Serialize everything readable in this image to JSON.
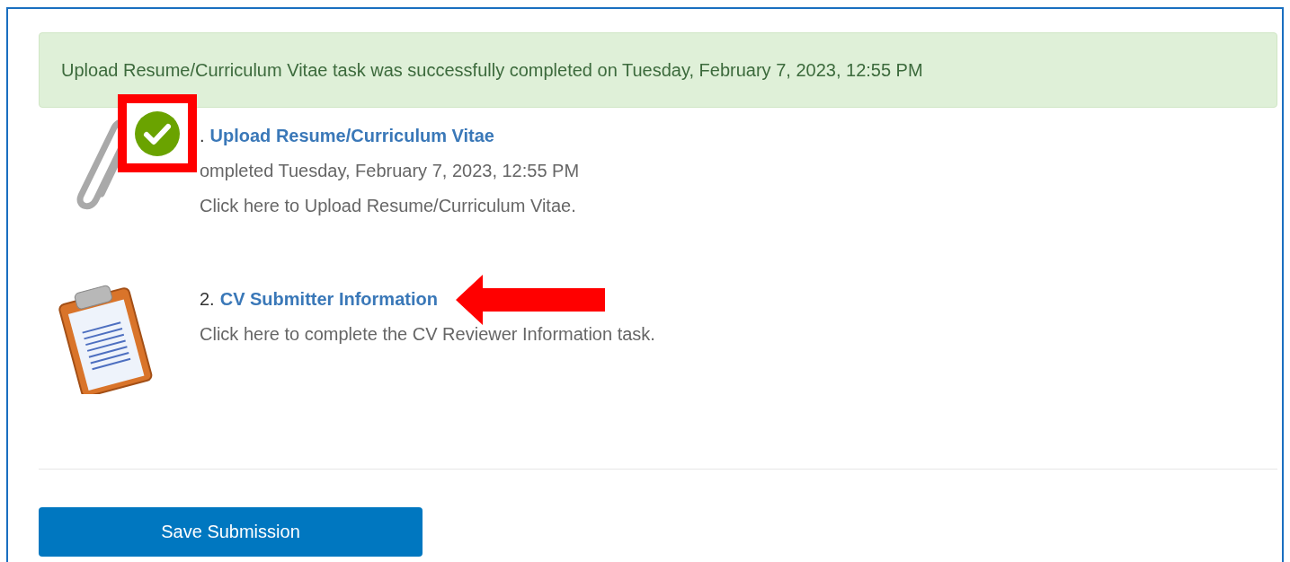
{
  "alert": {
    "text": "Upload Resume/Curriculum Vitae task was successfully completed on Tuesday, February 7, 2023, 12:55 PM"
  },
  "tasks": [
    {
      "kind": "attachment",
      "number": ".",
      "title": "Upload Resume/Curriculum Vitae",
      "completed": true,
      "highlighted": true,
      "pointed": false,
      "lines": [
        "ompleted Tuesday, February 7, 2023, 12:55 PM",
        "Click here to Upload Resume/Curriculum Vitae."
      ]
    },
    {
      "kind": "form",
      "number": "2.",
      "title": "CV Submitter Information",
      "completed": false,
      "highlighted": false,
      "pointed": true,
      "lines": [
        "Click here to complete the CV Reviewer Information task."
      ]
    }
  ],
  "button": {
    "label": "Save Submission"
  }
}
